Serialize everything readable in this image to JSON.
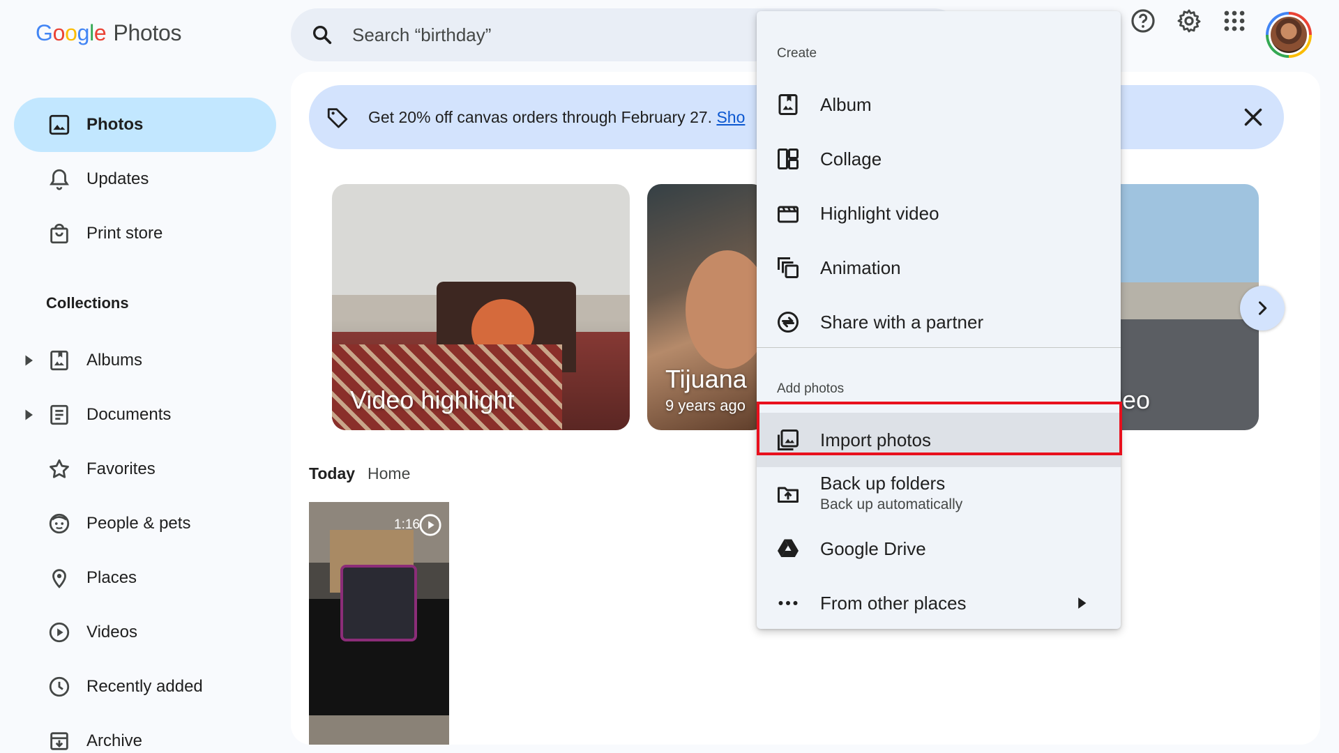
{
  "header": {
    "logo_letters": [
      "G",
      "o",
      "o",
      "g",
      "l",
      "e"
    ],
    "product": "Photos",
    "search_placeholder": "Search “birthday”"
  },
  "sidebar": {
    "items": [
      {
        "label": "Photos",
        "icon": "photo-icon",
        "active": true
      },
      {
        "label": "Updates",
        "icon": "bell-icon"
      },
      {
        "label": "Print store",
        "icon": "shopping-bag-icon"
      }
    ],
    "collections_label": "Collections",
    "collections": [
      {
        "label": "Albums",
        "icon": "album-icon",
        "expandable": true
      },
      {
        "label": "Documents",
        "icon": "document-icon",
        "expandable": true
      },
      {
        "label": "Favorites",
        "icon": "star-icon"
      },
      {
        "label": "People & pets",
        "icon": "face-icon"
      },
      {
        "label": "Places",
        "icon": "location-pin-icon"
      },
      {
        "label": "Videos",
        "icon": "play-circle-icon"
      },
      {
        "label": "Recently added",
        "icon": "clock-icon"
      },
      {
        "label": "Archive",
        "icon": "archive-icon"
      }
    ]
  },
  "banner": {
    "text": "Get 20% off canvas orders through February 27. ",
    "link": "Sho"
  },
  "memories": [
    {
      "title": "Video highlight"
    },
    {
      "title": "Tijuana",
      "subtitle": "9 years ago"
    },
    {
      "title": "ideo"
    }
  ],
  "timeline": {
    "date": "Today",
    "location": "Home",
    "items": [
      {
        "duration": "1:16"
      }
    ]
  },
  "menu": {
    "create_header": "Create",
    "create_items": [
      {
        "label": "Album",
        "icon": "album-icon"
      },
      {
        "label": "Collage",
        "icon": "collage-icon"
      },
      {
        "label": "Highlight video",
        "icon": "clapperboard-icon"
      },
      {
        "label": "Animation",
        "icon": "animation-icon"
      },
      {
        "label": "Share with a partner",
        "icon": "partner-share-icon"
      }
    ],
    "add_header": "Add photos",
    "add_items": [
      {
        "label": "Import photos",
        "icon": "import-photos-icon",
        "highlighted": true
      },
      {
        "label": "Back up folders",
        "sublabel": "Back up automatically",
        "icon": "folder-upload-icon"
      },
      {
        "label": "Google Drive",
        "icon": "google-drive-icon"
      },
      {
        "label": "From other places",
        "icon": "more-horiz-icon",
        "has_submenu": true
      }
    ]
  },
  "colors": {
    "active_nav": "#c2e7ff",
    "banner_bg": "#d3e3fd",
    "search_bg": "#e9eef6",
    "highlight_border": "#e8101d",
    "link": "#0b57d0"
  }
}
